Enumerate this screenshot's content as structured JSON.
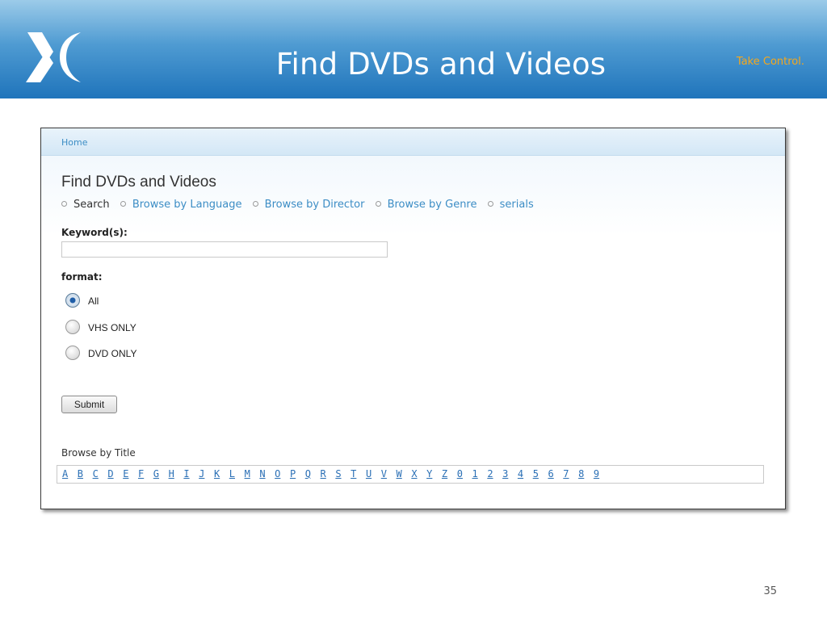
{
  "slide": {
    "title": "Find DVDs and Videos",
    "tagline": "Take Control.",
    "page_number": "35",
    "colors": {
      "header_blue": "#1f74bb",
      "tagline_orange": "#f6a81c"
    },
    "logo_icon": "x-logo-icon"
  },
  "screenshot": {
    "breadcrumb": {
      "home": "Home"
    },
    "heading": "Find DVDs and Videos",
    "nav": [
      {
        "label": "Search",
        "current": true
      },
      {
        "label": "Browse by Language",
        "current": false
      },
      {
        "label": "Browse by Director",
        "current": false
      },
      {
        "label": "Browse by Genre",
        "current": false
      },
      {
        "label": "serials",
        "current": false
      }
    ],
    "keyword": {
      "label": "Keyword(s):",
      "value": ""
    },
    "format": {
      "label": "format:",
      "options": [
        {
          "label": "All",
          "checked": true
        },
        {
          "label": "VHS ONLY",
          "checked": false
        },
        {
          "label": "DVD ONLY",
          "checked": false
        }
      ]
    },
    "submit_label": "Submit",
    "browse_by_title": {
      "heading": "Browse by Title",
      "links": [
        "A",
        "B",
        "C",
        "D",
        "E",
        "F",
        "G",
        "H",
        "I",
        "J",
        "K",
        "L",
        "M",
        "N",
        "O",
        "P",
        "Q",
        "R",
        "S",
        "T",
        "U",
        "V",
        "W",
        "X",
        "Y",
        "Z",
        "0",
        "1",
        "2",
        "3",
        "4",
        "5",
        "6",
        "7",
        "8",
        "9"
      ]
    },
    "colors": {
      "link": "#3c8dc5"
    }
  }
}
